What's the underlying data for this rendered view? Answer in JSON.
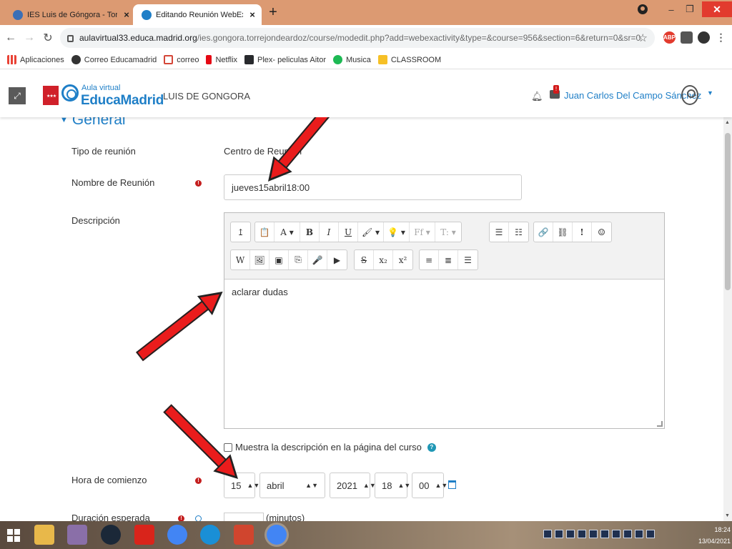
{
  "browser": {
    "tabs": [
      {
        "title": "IES Luis de Góngora - Torrejón d",
        "active": false
      },
      {
        "title": "Editando Reunión WebEx (WebE",
        "active": true
      }
    ],
    "new_tab": "+",
    "close_glyph": "×",
    "url_domain": "aulavirtual33.educa.madrid.org",
    "url_path": "/ies.gongora.torrejondeardoz/course/modedit.php?add=webexactivity&type=&course=956&section=6&return=0&sr=0",
    "bookmarks": [
      {
        "label": "Aplicaciones",
        "icon": "apps-grid-icon",
        "color": "#e94235"
      },
      {
        "label": "Correo Educamadrid",
        "icon": "globe-icon",
        "color": "#333333"
      },
      {
        "label": "correo",
        "icon": "gmail-icon",
        "color": "#d44638"
      },
      {
        "label": "Netflix",
        "icon": "netflix-icon",
        "color": "#e50914"
      },
      {
        "label": "Plex- peliculas Aitor",
        "icon": "plex-icon",
        "color": "#282a2d"
      },
      {
        "label": "Musica",
        "icon": "spotify-icon",
        "color": "#1db954"
      },
      {
        "label": "CLASSROOM",
        "icon": "classroom-icon",
        "color": "#f6c026"
      }
    ],
    "extensions": [
      {
        "name": "abp-extension-icon",
        "label": "ABP",
        "color": "#e23b2e"
      },
      {
        "name": "puzzle-extension-icon",
        "label": "",
        "color": "#555555"
      },
      {
        "name": "profile-extension-icon",
        "label": "",
        "color": "#333333"
      }
    ]
  },
  "site": {
    "logo_small": "Aula virtual",
    "logo_big": "EducaMadrid",
    "site_name": "LUIS DE GONGORA",
    "user_name": "Juan Carlos Del Campo Sánchez",
    "msg_badge": "!"
  },
  "form": {
    "section_title": "General",
    "tipo_label": "Tipo de reunión",
    "tipo_value": "Centro de Reunión",
    "nombre_label": "Nombre de Reunión",
    "nombre_value": "jueves15abril18:00",
    "descripcion_label": "Descripción",
    "descripcion_value": "aclarar dudas",
    "show_desc_label": "Muestra la descripción en la página del curso",
    "hora_label": "Hora de comienzo",
    "hora": {
      "day": "15",
      "month": "abril",
      "year": "2021",
      "hour": "18",
      "minute": "00"
    },
    "duracion_label": "Duración esperada",
    "duracion_unit": "(minutos)",
    "required_glyph": "!"
  },
  "editor_toolbar": {
    "row1": [
      [
        "↥"
      ],
      [
        "📋",
        "A ▾",
        "B",
        "I",
        "U",
        "🖌 ▾",
        "💡 ▾",
        "Ff ▾",
        "T: ▾"
      ],
      [
        "☰",
        "☷"
      ],
      [
        "🔗",
        "⛓",
        "!",
        "☺"
      ]
    ],
    "row2": [
      [
        "W",
        "🖼",
        "▣",
        "⎘",
        "🎤",
        "▶"
      ],
      [
        "S",
        "x₂",
        "x²"
      ],
      [
        "≡",
        "≣",
        "☰"
      ]
    ]
  },
  "taskbar": {
    "apps": [
      {
        "name": "file-explorer-icon",
        "color": "#e8b84a"
      },
      {
        "name": "winrar-icon",
        "color": "#8a6fa8"
      },
      {
        "name": "steam-icon",
        "color": "#1b2838"
      },
      {
        "name": "acrobat-icon",
        "color": "#d9241b"
      },
      {
        "name": "chrome-profile-icon",
        "color": "#4285f4"
      },
      {
        "name": "edge-icon",
        "color": "#1a8fd6"
      },
      {
        "name": "presentation-icon",
        "color": "#d0452e"
      },
      {
        "name": "chrome-icon",
        "color": "#4285f4"
      }
    ],
    "time": "18:24",
    "date": "13/04/2021"
  },
  "colors": {
    "accent": "#1f7fc7",
    "arrow": "#ea1c1c",
    "required": "#c41e1e"
  }
}
